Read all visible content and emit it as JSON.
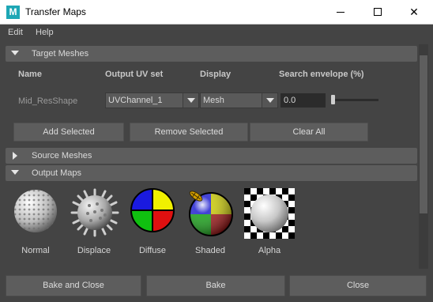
{
  "window": {
    "app_icon_letter": "M",
    "title": "Transfer Maps",
    "minimize_glyph": "—",
    "close_glyph": "✕"
  },
  "menu": {
    "items": [
      "Edit",
      "Help"
    ]
  },
  "target_meshes": {
    "header": "Target Meshes",
    "expanded": true,
    "columns": {
      "name": "Name",
      "output_uv_set": "Output UV set",
      "display": "Display",
      "search_envelope": "Search envelope (%)"
    },
    "row": {
      "name": "Mid_ResShape",
      "uv_set": "UVChannel_1",
      "display": "Mesh",
      "envelope": "0.0",
      "envelope_slider_fraction": 0.0
    },
    "buttons": {
      "add": "Add Selected",
      "remove": "Remove Selected",
      "clear": "Clear All"
    }
  },
  "source_meshes": {
    "header": "Source Meshes",
    "expanded": false
  },
  "output_maps": {
    "header": "Output Maps",
    "expanded": true,
    "maps": [
      {
        "label": "Normal",
        "icon": "normal-map-sphere-icon"
      },
      {
        "label": "Displace",
        "icon": "displace-map-sphere-icon"
      },
      {
        "label": "Diffuse",
        "icon": "diffuse-map-sphere-icon"
      },
      {
        "label": "Shaded",
        "icon": "shaded-map-sphere-icon"
      },
      {
        "label": "Alpha",
        "icon": "alpha-map-checker-icon"
      }
    ]
  },
  "footer": {
    "bake_close": "Bake and Close",
    "bake": "Bake",
    "close": "Close"
  },
  "colors": {
    "panel_bg": "#444444",
    "frame_header": "#5d5d5d",
    "button": "#5d5d5d",
    "field_bg": "#2b2b2b",
    "app_icon": "#1da7b5"
  }
}
